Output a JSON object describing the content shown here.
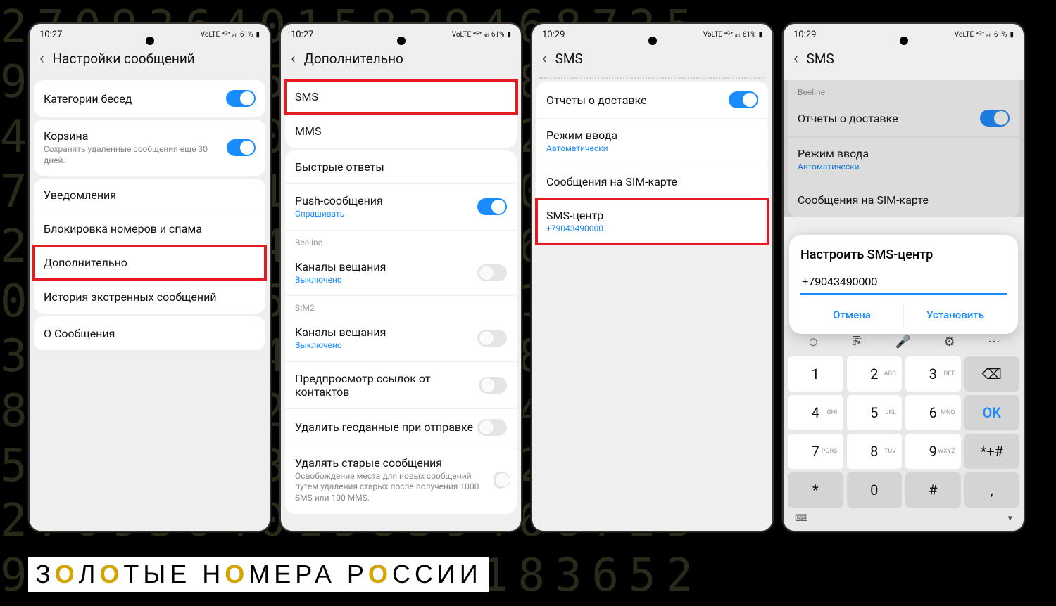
{
  "bg_digits": "2709364015839468725\n9836471520947183652\n4158293067418529306\n7294036185729403618\n2583691470258369147\n0947182536094718253\n3615829407361582940\n8130475296813047529\n5469208371546920837\n2709364015839468725\n9836471520947183652",
  "phones": [
    {
      "time": "10:27",
      "battery": "61%",
      "title": "Настройки сообщений",
      "rows": [
        {
          "k": "group",
          "items": [
            {
              "label": "Категории бесед",
              "toggle": "on"
            }
          ]
        },
        {
          "k": "group",
          "items": [
            {
              "label": "Корзина",
              "sub": "Сохранять удаленные сообщения еще 30 дней.",
              "toggle": "on"
            }
          ]
        },
        {
          "k": "group",
          "items": [
            {
              "label": "Уведомления"
            },
            {
              "label": "Блокировка номеров и спама"
            },
            {
              "label": "Дополнительно",
              "hl": true
            },
            {
              "label": "История экстренных сообщений"
            }
          ]
        },
        {
          "k": "group",
          "items": [
            {
              "label": "О Сообщения"
            }
          ]
        }
      ]
    },
    {
      "time": "10:27",
      "battery": "61%",
      "title": "Дополнительно",
      "rows": [
        {
          "k": "group",
          "items": [
            {
              "label": "SMS",
              "hl": true
            },
            {
              "label": "MMS"
            }
          ]
        },
        {
          "k": "group",
          "items": [
            {
              "label": "Быстрые ответы"
            },
            {
              "label": "Push-сообщения",
              "sub": "Спрашивать",
              "subblue": true,
              "toggle": "on"
            },
            {
              "section": "Beeline"
            },
            {
              "label": "Каналы вещания",
              "sub": "Выключено",
              "subblue": true,
              "toggle": "off"
            },
            {
              "section": "SIM2"
            },
            {
              "label": "Каналы вещания",
              "sub": "Выключено",
              "subblue": true,
              "toggle": "off"
            },
            {
              "label": "Предпросмотр ссылок от контактов",
              "toggle": "off"
            },
            {
              "label": "Удалить геоданные при отправке",
              "toggle": "off"
            },
            {
              "label": "Удалять старые сообщения",
              "sub": "Освобождение места для новых сообщений путем удаления старых после получения 1000 SMS или 100 MMS.",
              "toggle": "off"
            }
          ]
        }
      ]
    },
    {
      "time": "10:29",
      "battery": "61%",
      "title": "SMS",
      "rows": [
        {
          "k": "dotted"
        },
        {
          "k": "group",
          "items": [
            {
              "label": "Отчеты о доставке",
              "toggle": "on"
            },
            {
              "label": "Режим ввода",
              "sub": "Автоматически",
              "subblue": true
            },
            {
              "label": "Сообщения на SIM-карте"
            },
            {
              "label": "SMS-центр",
              "sub": "+79043490000",
              "subblue": true,
              "hl": true
            }
          ]
        }
      ]
    },
    {
      "time": "10:29",
      "battery": "61%",
      "title": "SMS",
      "dim": true,
      "rows": [
        {
          "k": "group",
          "items": [
            {
              "section": "Beeline"
            },
            {
              "label": "Отчеты о доставке",
              "toggle": "on"
            },
            {
              "label": "Режим ввода",
              "sub": "Автоматически",
              "subblue": true
            },
            {
              "label": "Сообщения на SIM-карте"
            }
          ]
        }
      ],
      "dialog": {
        "title": "Настроить SMS-центр",
        "value": "+79043490000",
        "cancel": "Отмена",
        "ok": "Установить"
      },
      "keyboard": {
        "keys": [
          [
            "1",
            ""
          ],
          [
            "2",
            "ABC"
          ],
          [
            "3",
            "DEF"
          ],
          [
            "⌫",
            ""
          ],
          [
            "4",
            "GHI"
          ],
          [
            "5",
            "JKL"
          ],
          [
            "6",
            "MNO"
          ],
          [
            "OK",
            ""
          ],
          [
            "7",
            "PQRS"
          ],
          [
            "8",
            "TUV"
          ],
          [
            "9",
            "WXYZ"
          ],
          [
            "*+#",
            ""
          ],
          [
            "*",
            ""
          ],
          [
            "0",
            ""
          ],
          [
            "#",
            ""
          ],
          [
            ",",
            ""
          ]
        ]
      }
    }
  ],
  "footer": {
    "z": "З",
    "o": "О",
    "t1": "Л",
    "t2": "ТЫЕ Н",
    "t3": "МЕРА Р",
    "t4": "ССИИ"
  },
  "status_icons": "VoLTE ⁴ᴳ⁺ ₐₗₗ"
}
